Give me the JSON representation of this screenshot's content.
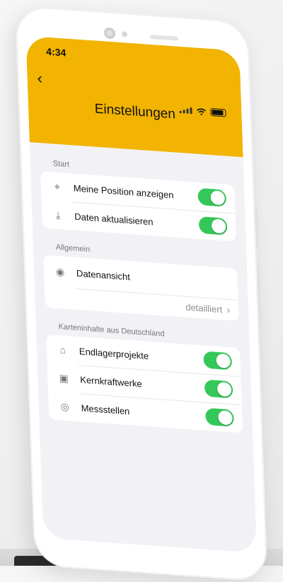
{
  "status_bar": {
    "time": "4:34"
  },
  "header": {
    "title": "Einstellungen",
    "back_icon": "chevron-left-icon"
  },
  "sections": [
    {
      "label": "Start",
      "rows": [
        {
          "icon": "location-crosshair-icon",
          "label": "Meine Position anzeigen",
          "toggle": true
        },
        {
          "icon": "download-icon",
          "label": "Daten aktualisieren",
          "toggle": true
        }
      ]
    },
    {
      "label": "Allgemein",
      "rows": [
        {
          "icon": "eye-icon",
          "label": "Datenansicht",
          "value": "detailliert",
          "chevron": true
        }
      ]
    },
    {
      "label": "Karteninhalte aus Deutschland",
      "rows": [
        {
          "icon": "warehouse-icon",
          "label": "Endlagerprojekte",
          "toggle": true
        },
        {
          "icon": "factory-icon",
          "label": "Kernkraftwerke",
          "toggle": true
        },
        {
          "icon": "radio-waves-icon",
          "label": "Messstellen",
          "toggle": true
        }
      ]
    }
  ],
  "colors": {
    "accent": "#f2b400",
    "toggle_on": "#34c759",
    "background": "#f2f2f6"
  }
}
